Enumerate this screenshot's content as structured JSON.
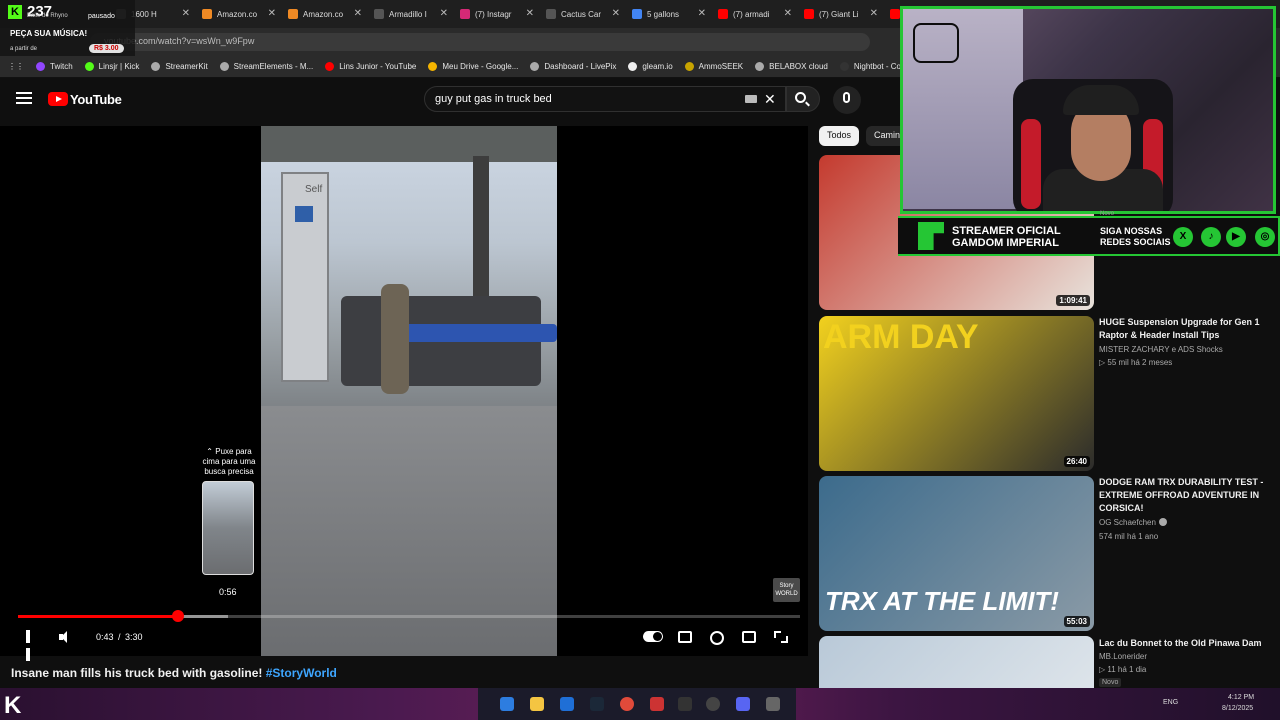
{
  "browser": {
    "tabs": [
      {
        "label": "1600 H",
        "color": "#555555"
      },
      {
        "label": "Amazon.co",
        "color": "#f08a24"
      },
      {
        "label": "Amazon.co",
        "color": "#f08a24"
      },
      {
        "label": "Armadillo I",
        "color": "#555555"
      },
      {
        "label": "(7) Instagr",
        "color": "#d62976"
      },
      {
        "label": "Cactus Car",
        "color": "#555555"
      },
      {
        "label": "5 gallons",
        "color": "#4285f4"
      },
      {
        "label": "(7) armadi",
        "color": "#ff0000"
      },
      {
        "label": "(7) Giant Li",
        "color": "#ff0000"
      },
      {
        "label": "R",
        "color": "#ff0000"
      }
    ],
    "url": "youtube.com/watch?v=wsWn_w9Fpw",
    "bookmarks": [
      {
        "label": "Twitch",
        "color": "#9146ff"
      },
      {
        "label": "Linsjr | Kick",
        "color": "#53fc18"
      },
      {
        "label": "StreamerKit",
        "color": "#aaaaaa"
      },
      {
        "label": "StreamElements - M...",
        "color": "#aaaaaa"
      },
      {
        "label": "Lins Junior - YouTube",
        "color": "#ff0000"
      },
      {
        "label": "Meu Drive - Google...",
        "color": "#f4b400"
      },
      {
        "label": "Dashboard - LivePix",
        "color": "#aaaaaa"
      },
      {
        "label": "gleam.io",
        "color": "#eeeeee"
      },
      {
        "label": "AmmoSEEK",
        "color": "#c8a400"
      },
      {
        "label": "BELABOX cloud",
        "color": "#aaaaaa"
      },
      {
        "label": "Nightbot - Comm",
        "color": "#333333"
      }
    ]
  },
  "twitch_overlay": {
    "viewer_count": "237",
    "user": "Baile do Rhyno",
    "status": "pausado",
    "music_title": "PEÇA SUA MÚSICA!",
    "music_from": "a partir de",
    "price": "R$ 3.00"
  },
  "youtube": {
    "logo_text": "YouTube",
    "search_value": "guy put gas in truck bed",
    "player": {
      "pull_hint": "Puxe para cima para uma busca precisa",
      "preview_time": "0:56",
      "watermark": "Story WORLD",
      "sign_text": "Self",
      "current_time": "0:43",
      "separator": "/",
      "duration": "3:30",
      "progress_fraction": 0.205,
      "buffer_fraction": 0.269
    },
    "video_title": "Insane man fills his truck bed with gasoline!",
    "video_hashtag": "#StoryWorld",
    "chips": [
      "Todos",
      "Camin"
    ],
    "recommendations": [
      {
        "title": "",
        "channel": "",
        "meta": "",
        "duration": "1:09:41",
        "colors": [
          "#c43a2e",
          "#e8e3dc"
        ]
      },
      {
        "title": "HUGE Suspension Upgrade for Gen 1 Raptor & Header Install Tips",
        "channel": "MISTER ZACHARY e ADS Shocks",
        "meta": "▷ 55 mil  há 2 meses",
        "duration": "26:40",
        "thumb_text": "ARM DAY",
        "colors": [
          "#f2d11e",
          "#2b2b2b"
        ]
      },
      {
        "title": "DODGE RAM TRX DURABILITY TEST - EXTREME OFFROAD ADVENTURE IN CORSICA!",
        "channel": "OG Schaefchen",
        "meta": "574 mil  há 1 ano",
        "duration": "55:03",
        "thumb_text": "TRX AT THE LIMIT!",
        "colors": [
          "#3c6b8c",
          "#8a9aa6"
        ]
      },
      {
        "title": "Lac du Bonnet to the Old Pinawa Dam",
        "channel": "MB.Lonerider",
        "meta": "▷ 11  há 1 dia",
        "duration": "",
        "colors": [
          "#b9c9d8",
          "#dde4ea"
        ]
      }
    ],
    "badge_new": "Novo"
  },
  "webcam": {
    "banner_line1": "STREAMER OFICIAL",
    "banner_line2": "GAMDOM IMPERIAL",
    "social_line1": "SIGA NOSSAS",
    "social_line2": "REDES SOCIAIS",
    "novo": "Novo",
    "accent": "#25c634"
  },
  "taskbar": {
    "lang": "ENG",
    "time": "4:12 PM",
    "date": "8/12/2025"
  }
}
